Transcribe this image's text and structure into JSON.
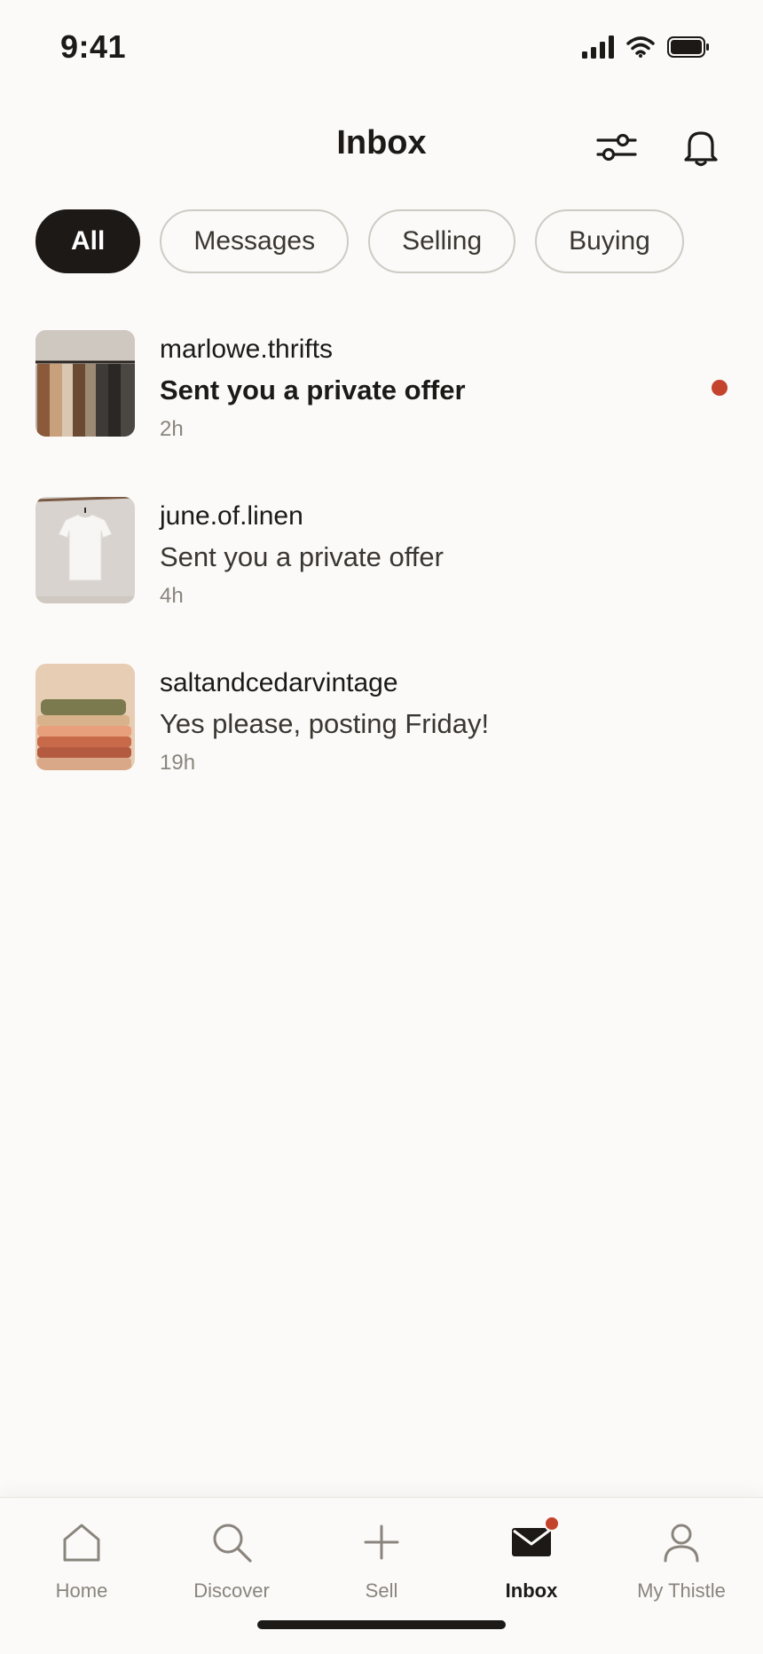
{
  "status_bar": {
    "time": "9:41"
  },
  "header": {
    "title": "Inbox",
    "filter_icon": "sliders-icon",
    "bell_icon": "bell-icon"
  },
  "filters": [
    {
      "label": "All",
      "active": true
    },
    {
      "label": "Messages",
      "active": false
    },
    {
      "label": "Selling",
      "active": false
    },
    {
      "label": "Buying",
      "active": false
    }
  ],
  "conversations": [
    {
      "user": "marlowe.thrifts",
      "message": "Sent you a private offer",
      "time": "2h",
      "unread": true,
      "thumb": "clothing-rack"
    },
    {
      "user": "june.of.linen",
      "message": "Sent you a private offer",
      "time": "4h",
      "unread": false,
      "thumb": "white-tee"
    },
    {
      "user": "saltandcedarvintage",
      "message": "Yes please, posting Friday!",
      "time": "19h",
      "unread": false,
      "thumb": "folded-stack"
    }
  ],
  "tabbar": {
    "items": [
      {
        "label": "Home",
        "icon": "home-icon"
      },
      {
        "label": "Discover",
        "icon": "search-icon"
      },
      {
        "label": "Sell",
        "icon": "plus-icon"
      },
      {
        "label": "Inbox",
        "icon": "mail-icon",
        "active": true,
        "badge": true
      },
      {
        "label": "My Thistle",
        "icon": "user-icon"
      }
    ]
  },
  "colors": {
    "accent": "#c4432c",
    "ink": "#1c1917",
    "muted": "#8a847d",
    "background": "#fbfaf8"
  }
}
